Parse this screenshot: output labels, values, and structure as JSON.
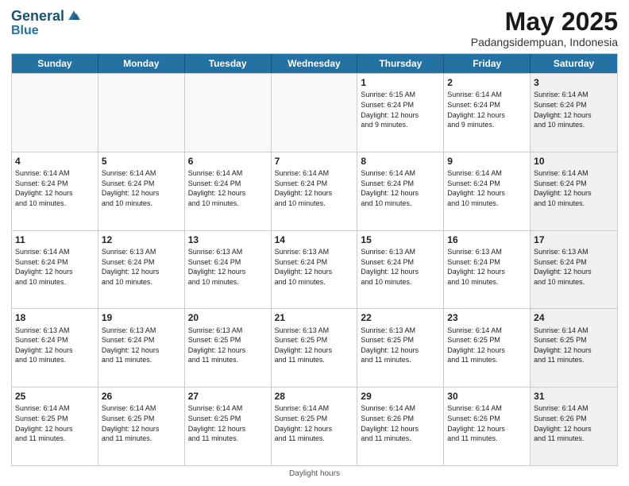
{
  "logo": {
    "line1": "General",
    "line2": "Blue"
  },
  "title": "May 2025",
  "subtitle": "Padangsidempuan, Indonesia",
  "header_days": [
    "Sunday",
    "Monday",
    "Tuesday",
    "Wednesday",
    "Thursday",
    "Friday",
    "Saturday"
  ],
  "footer": "Daylight hours",
  "weeks": [
    [
      {
        "day": "",
        "info": "",
        "empty": true
      },
      {
        "day": "",
        "info": "",
        "empty": true
      },
      {
        "day": "",
        "info": "",
        "empty": true
      },
      {
        "day": "",
        "info": "",
        "empty": true
      },
      {
        "day": "1",
        "info": "Sunrise: 6:15 AM\nSunset: 6:24 PM\nDaylight: 12 hours\nand 9 minutes."
      },
      {
        "day": "2",
        "info": "Sunrise: 6:14 AM\nSunset: 6:24 PM\nDaylight: 12 hours\nand 9 minutes."
      },
      {
        "day": "3",
        "info": "Sunrise: 6:14 AM\nSunset: 6:24 PM\nDaylight: 12 hours\nand 10 minutes.",
        "shaded": true
      }
    ],
    [
      {
        "day": "4",
        "info": "Sunrise: 6:14 AM\nSunset: 6:24 PM\nDaylight: 12 hours\nand 10 minutes."
      },
      {
        "day": "5",
        "info": "Sunrise: 6:14 AM\nSunset: 6:24 PM\nDaylight: 12 hours\nand 10 minutes."
      },
      {
        "day": "6",
        "info": "Sunrise: 6:14 AM\nSunset: 6:24 PM\nDaylight: 12 hours\nand 10 minutes."
      },
      {
        "day": "7",
        "info": "Sunrise: 6:14 AM\nSunset: 6:24 PM\nDaylight: 12 hours\nand 10 minutes."
      },
      {
        "day": "8",
        "info": "Sunrise: 6:14 AM\nSunset: 6:24 PM\nDaylight: 12 hours\nand 10 minutes."
      },
      {
        "day": "9",
        "info": "Sunrise: 6:14 AM\nSunset: 6:24 PM\nDaylight: 12 hours\nand 10 minutes."
      },
      {
        "day": "10",
        "info": "Sunrise: 6:14 AM\nSunset: 6:24 PM\nDaylight: 12 hours\nand 10 minutes.",
        "shaded": true
      }
    ],
    [
      {
        "day": "11",
        "info": "Sunrise: 6:14 AM\nSunset: 6:24 PM\nDaylight: 12 hours\nand 10 minutes."
      },
      {
        "day": "12",
        "info": "Sunrise: 6:13 AM\nSunset: 6:24 PM\nDaylight: 12 hours\nand 10 minutes."
      },
      {
        "day": "13",
        "info": "Sunrise: 6:13 AM\nSunset: 6:24 PM\nDaylight: 12 hours\nand 10 minutes."
      },
      {
        "day": "14",
        "info": "Sunrise: 6:13 AM\nSunset: 6:24 PM\nDaylight: 12 hours\nand 10 minutes."
      },
      {
        "day": "15",
        "info": "Sunrise: 6:13 AM\nSunset: 6:24 PM\nDaylight: 12 hours\nand 10 minutes."
      },
      {
        "day": "16",
        "info": "Sunrise: 6:13 AM\nSunset: 6:24 PM\nDaylight: 12 hours\nand 10 minutes."
      },
      {
        "day": "17",
        "info": "Sunrise: 6:13 AM\nSunset: 6:24 PM\nDaylight: 12 hours\nand 10 minutes.",
        "shaded": true
      }
    ],
    [
      {
        "day": "18",
        "info": "Sunrise: 6:13 AM\nSunset: 6:24 PM\nDaylight: 12 hours\nand 10 minutes."
      },
      {
        "day": "19",
        "info": "Sunrise: 6:13 AM\nSunset: 6:24 PM\nDaylight: 12 hours\nand 11 minutes."
      },
      {
        "day": "20",
        "info": "Sunrise: 6:13 AM\nSunset: 6:25 PM\nDaylight: 12 hours\nand 11 minutes."
      },
      {
        "day": "21",
        "info": "Sunrise: 6:13 AM\nSunset: 6:25 PM\nDaylight: 12 hours\nand 11 minutes."
      },
      {
        "day": "22",
        "info": "Sunrise: 6:13 AM\nSunset: 6:25 PM\nDaylight: 12 hours\nand 11 minutes."
      },
      {
        "day": "23",
        "info": "Sunrise: 6:14 AM\nSunset: 6:25 PM\nDaylight: 12 hours\nand 11 minutes."
      },
      {
        "day": "24",
        "info": "Sunrise: 6:14 AM\nSunset: 6:25 PM\nDaylight: 12 hours\nand 11 minutes.",
        "shaded": true
      }
    ],
    [
      {
        "day": "25",
        "info": "Sunrise: 6:14 AM\nSunset: 6:25 PM\nDaylight: 12 hours\nand 11 minutes."
      },
      {
        "day": "26",
        "info": "Sunrise: 6:14 AM\nSunset: 6:25 PM\nDaylight: 12 hours\nand 11 minutes."
      },
      {
        "day": "27",
        "info": "Sunrise: 6:14 AM\nSunset: 6:25 PM\nDaylight: 12 hours\nand 11 minutes."
      },
      {
        "day": "28",
        "info": "Sunrise: 6:14 AM\nSunset: 6:25 PM\nDaylight: 12 hours\nand 11 minutes."
      },
      {
        "day": "29",
        "info": "Sunrise: 6:14 AM\nSunset: 6:26 PM\nDaylight: 12 hours\nand 11 minutes."
      },
      {
        "day": "30",
        "info": "Sunrise: 6:14 AM\nSunset: 6:26 PM\nDaylight: 12 hours\nand 11 minutes."
      },
      {
        "day": "31",
        "info": "Sunrise: 6:14 AM\nSunset: 6:26 PM\nDaylight: 12 hours\nand 11 minutes.",
        "shaded": true
      }
    ]
  ]
}
